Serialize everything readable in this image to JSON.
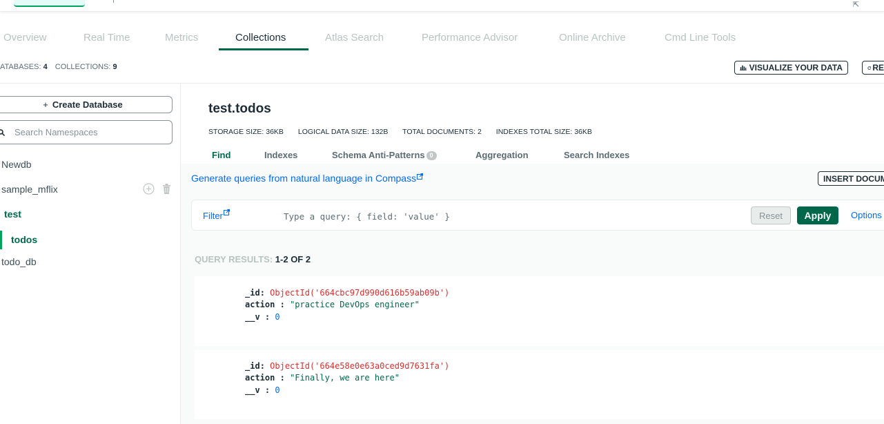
{
  "top_icon": "expand-icon",
  "main_tabs": [
    "Overview",
    "Real Time",
    "Metrics",
    "Collections",
    "Atlas Search",
    "Performance Advisor",
    "Online Archive",
    "Cmd Line Tools"
  ],
  "counts": {
    "databases_label": "ATABASES:",
    "databases_value": "4",
    "collections_label": "COLLECTIONS:",
    "collections_value": "9"
  },
  "toolbar": {
    "visualize_label": "VISUALIZE YOUR DATA",
    "refresh_label": "RE"
  },
  "sidebar": {
    "create_label": "Create Database",
    "search_placeholder": "Search Namespaces",
    "items": [
      "Newdb",
      "sample_mflix",
      "test",
      "todos",
      "todo_db"
    ]
  },
  "collection": {
    "title": "test.todos",
    "stats": {
      "storage": "STORAGE SIZE: 36KB",
      "logical": "LOGICAL DATA SIZE: 132B",
      "total_docs": "TOTAL DOCUMENTS: 2",
      "indexes": "INDEXES TOTAL SIZE: 36KB"
    },
    "tabs": {
      "find": "Find",
      "indexes": "Indexes",
      "schema": "Schema Anti-Patterns",
      "schema_badge": "0",
      "aggregation": "Aggregation",
      "search_indexes": "Search Indexes"
    }
  },
  "query": {
    "nl_link": "Generate queries from natural language in Compass",
    "insert_label": "INSERT DOCUMENT",
    "filter_label": "Filter",
    "filter_placeholder": "Type a query: { field: 'value' }",
    "reset_label": "Reset",
    "apply_label": "Apply",
    "options_label": "Options"
  },
  "results": {
    "label": "QUERY RESULTS:",
    "range": "1-2 OF 2"
  },
  "documents": [
    {
      "id_key": "_id",
      "id_sep": ":",
      "id_value": "ObjectId('664cbc97d990d616b59ab09b')",
      "action_key": "action",
      "action_sep": ":",
      "action_value": "\"practice DevOps engineer\"",
      "v_key": "__v",
      "v_sep": ":",
      "v_value": "0"
    },
    {
      "id_key": "_id",
      "id_sep": ":",
      "id_value": "ObjectId('664e58e0e63a0ced9d7631fa')",
      "action_key": "action",
      "action_sep": ":",
      "action_value": "\"Finally, we are here\"",
      "v_key": "__v",
      "v_sep": ":",
      "v_value": "0"
    }
  ],
  "colors": {
    "accent": "#00684a",
    "accent_bright": "#00a35c",
    "link": "#016bf8",
    "objectid": "#db3030"
  }
}
